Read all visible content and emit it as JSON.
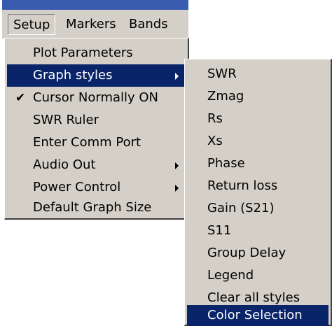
{
  "menubar": {
    "items": [
      {
        "label": "Setup"
      },
      {
        "label": "Markers"
      },
      {
        "label": "Bands"
      }
    ]
  },
  "setup_menu": {
    "items": [
      {
        "label": "Plot Parameters"
      },
      {
        "label": "Graph styles"
      },
      {
        "label": "Cursor Normally ON"
      },
      {
        "label": "SWR Ruler"
      },
      {
        "label": "Enter Comm Port"
      },
      {
        "label": "Audio Out"
      },
      {
        "label": "Power Control"
      },
      {
        "label": "Default Graph Size"
      }
    ],
    "check_glyph": "✔"
  },
  "graph_styles_menu": {
    "items": [
      {
        "label": "SWR"
      },
      {
        "label": "Zmag"
      },
      {
        "label": "Rs"
      },
      {
        "label": "Xs"
      },
      {
        "label": "Phase"
      },
      {
        "label": "Return loss"
      },
      {
        "label": "Gain (S21)"
      },
      {
        "label": "S11"
      },
      {
        "label": "Group Delay"
      },
      {
        "label": "Legend"
      },
      {
        "label": "Clear all styles"
      },
      {
        "label": "Color Selection"
      }
    ]
  },
  "colors": {
    "menu_bg": "#d4d0c8",
    "highlight": "#0a246a",
    "highlight_text": "#ffffff",
    "title_strip": "#3a5cb0"
  }
}
